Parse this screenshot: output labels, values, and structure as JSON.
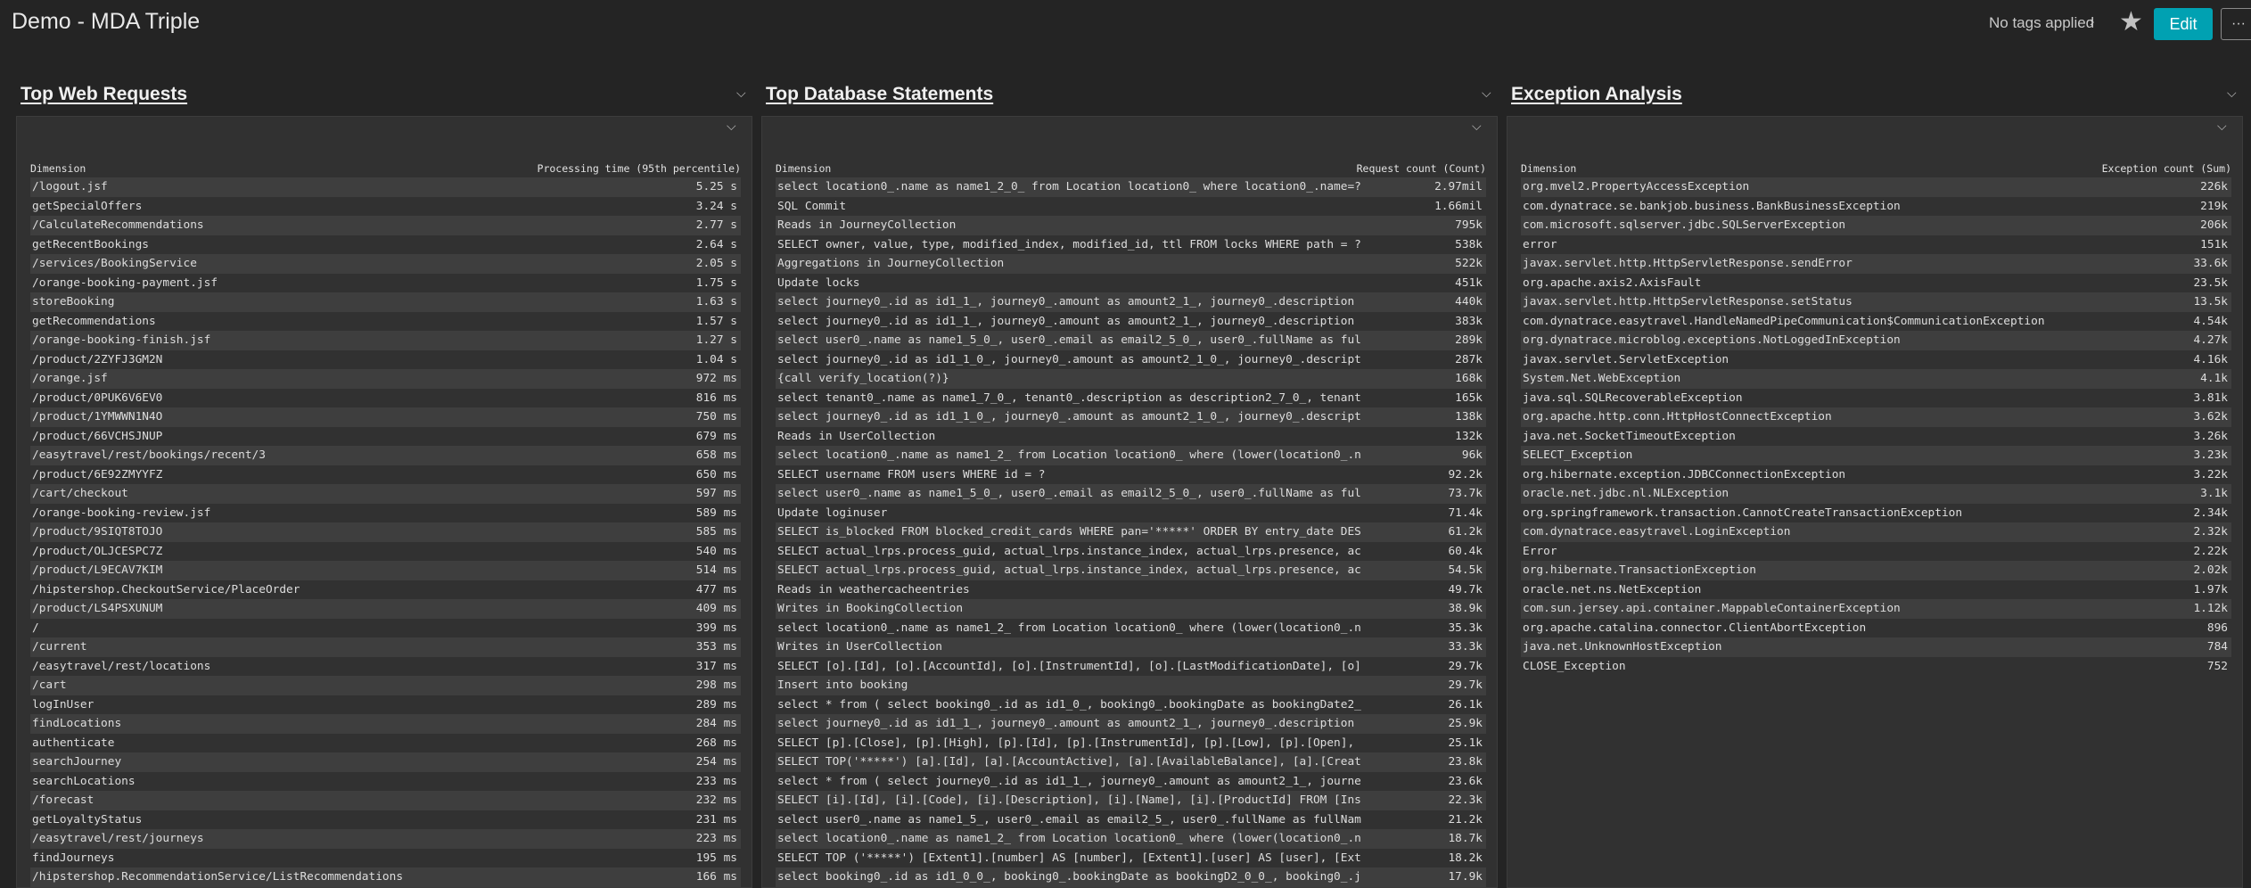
{
  "header": {
    "title": "Demo - MDA Triple",
    "tags_label": "No tags applied",
    "edit_label": "Edit",
    "more_label": "···"
  },
  "sections": [
    {
      "title": "Top Web Requests",
      "col_dim": "Dimension",
      "col_val": "Processing time (95th percentile)",
      "rows": [
        [
          "/logout.jsf",
          "5.25 s"
        ],
        [
          "getSpecialOffers",
          "3.24 s"
        ],
        [
          "/CalculateRecommendations",
          "2.77 s"
        ],
        [
          "getRecentBookings",
          "2.64 s"
        ],
        [
          "/services/BookingService",
          "2.05 s"
        ],
        [
          "/orange-booking-payment.jsf",
          "1.75 s"
        ],
        [
          "storeBooking",
          "1.63 s"
        ],
        [
          "getRecommendations",
          "1.57 s"
        ],
        [
          "/orange-booking-finish.jsf",
          "1.27 s"
        ],
        [
          "/product/2ZYFJ3GM2N",
          "1.04 s"
        ],
        [
          "/orange.jsf",
          "972 ms"
        ],
        [
          "/product/0PUK6V6EV0",
          "816 ms"
        ],
        [
          "/product/1YMWWN1N4O",
          "750 ms"
        ],
        [
          "/product/66VCHSJNUP",
          "679 ms"
        ],
        [
          "/easytravel/rest/bookings/recent/3",
          "658 ms"
        ],
        [
          "/product/6E92ZMYYFZ",
          "650 ms"
        ],
        [
          "/cart/checkout",
          "597 ms"
        ],
        [
          "/orange-booking-review.jsf",
          "589 ms"
        ],
        [
          "/product/9SIQT8TOJO",
          "585 ms"
        ],
        [
          "/product/OLJCESPC7Z",
          "540 ms"
        ],
        [
          "/product/L9ECAV7KIM",
          "514 ms"
        ],
        [
          "/hipstershop.CheckoutService/PlaceOrder",
          "477 ms"
        ],
        [
          "/product/LS4PSXUNUM",
          "409 ms"
        ],
        [
          "/",
          "399 ms"
        ],
        [
          "/current",
          "353 ms"
        ],
        [
          "/easytravel/rest/locations",
          "317 ms"
        ],
        [
          "/cart",
          "298 ms"
        ],
        [
          "logInUser",
          "289 ms"
        ],
        [
          "findLocations",
          "284 ms"
        ],
        [
          "authenticate",
          "268 ms"
        ],
        [
          "searchJourney",
          "254 ms"
        ],
        [
          "searchLocations",
          "233 ms"
        ],
        [
          "/forecast",
          "232 ms"
        ],
        [
          "getLoyaltyStatus",
          "231 ms"
        ],
        [
          "/easytravel/rest/journeys",
          "223 ms"
        ],
        [
          "findJourneys",
          "195 ms"
        ],
        [
          "/hipstershop.RecommendationService/ListRecommendations",
          "166 ms"
        ]
      ]
    },
    {
      "title": "Top Database Statements",
      "col_dim": "Dimension",
      "col_val": "Request count (Count)",
      "rows": [
        [
          "select location0_.name as name1_2_0_ from Location location0_ where location0_.name=?",
          "2.97mil"
        ],
        [
          "SQL Commit",
          "1.66mil"
        ],
        [
          "Reads in JourneyCollection",
          "795k"
        ],
        [
          "SELECT owner, value, type, modified_index, modified_id, ttl FROM locks WHERE path = ?",
          "538k"
        ],
        [
          "Aggregations in JourneyCollection",
          "522k"
        ],
        [
          "Update locks",
          "451k"
        ],
        [
          "select journey0_.id as id1_1_, journey0_.amount as amount2_1_, journey0_.description",
          "440k"
        ],
        [
          "select journey0_.id as id1_1_, journey0_.amount as amount2_1_, journey0_.description",
          "383k"
        ],
        [
          "select user0_.name as name1_5_0_, user0_.email as email2_5_0_, user0_.fullName as ful",
          "289k"
        ],
        [
          "select journey0_.id as id1_1_0_, journey0_.amount as amount2_1_0_, journey0_.descript",
          "287k"
        ],
        [
          "{call verify_location(?)}",
          "168k"
        ],
        [
          "select tenant0_.name as name1_7_0_, tenant0_.description as description2_7_0_, tenant",
          "165k"
        ],
        [
          "select journey0_.id as id1_1_0_, journey0_.amount as amount2_1_0_, journey0_.descript",
          "138k"
        ],
        [
          "Reads in UserCollection",
          "132k"
        ],
        [
          "select location0_.name as name1_2_ from Location location0_ where (lower(location0_.n",
          "96k"
        ],
        [
          "SELECT username FROM users WHERE id = ?",
          "92.2k"
        ],
        [
          "select user0_.name as name1_5_0_, user0_.email as email2_5_0_, user0_.fullName as ful",
          "73.7k"
        ],
        [
          "Update loginuser",
          "71.4k"
        ],
        [
          "SELECT is_blocked FROM blocked_credit_cards WHERE pan='*****' ORDER BY entry_date DES",
          "61.2k"
        ],
        [
          "SELECT actual_lrps.process_guid, actual_lrps.instance_index, actual_lrps.presence, ac",
          "60.4k"
        ],
        [
          "SELECT actual_lrps.process_guid, actual_lrps.instance_index, actual_lrps.presence, ac",
          "54.5k"
        ],
        [
          "Reads in weathercacheentries",
          "49.7k"
        ],
        [
          "Writes in BookingCollection",
          "38.9k"
        ],
        [
          "select location0_.name as name1_2_ from Location location0_ where (lower(location0_.n",
          "35.3k"
        ],
        [
          "Writes in UserCollection",
          "33.3k"
        ],
        [
          "SELECT [o].[Id], [o].[AccountId], [o].[InstrumentId], [o].[LastModificationDate], [o]",
          "29.7k"
        ],
        [
          "Insert into booking",
          "29.7k"
        ],
        [
          "select * from ( select booking0_.id as id1_0_, booking0_.bookingDate as bookingDate2_",
          "26.1k"
        ],
        [
          "select journey0_.id as id1_1_, journey0_.amount as amount2_1_, journey0_.description",
          "25.9k"
        ],
        [
          "SELECT [p].[Close], [p].[High], [p].[Id], [p].[InstrumentId], [p].[Low], [p].[Open],",
          "25.1k"
        ],
        [
          "SELECT TOP('*****') [a].[Id], [a].[AccountActive], [a].[AvailableBalance], [a].[Creat",
          "23.8k"
        ],
        [
          "select * from ( select journey0_.id as id1_1_, journey0_.amount as amount2_1_, journe",
          "23.6k"
        ],
        [
          "SELECT [i].[Id], [i].[Code], [i].[Description], [i].[Name], [i].[ProductId] FROM [Ins",
          "22.3k"
        ],
        [
          "select user0_.name as name1_5_, user0_.email as email2_5_, user0_.fullName as fullNam",
          "21.2k"
        ],
        [
          "select location0_.name as name1_2_ from Location location0_ where (lower(location0_.n",
          "18.7k"
        ],
        [
          "SELECT TOP ('*****') [Extent1].[number] AS [number], [Extent1].[user] AS [user], [Ext",
          "18.2k"
        ],
        [
          "select booking0_.id as id1_0_0_, booking0_.bookingDate as bookingD2_0_0_, booking0_.j",
          "17.9k"
        ]
      ]
    },
    {
      "title": "Exception Analysis",
      "col_dim": "Dimension",
      "col_val": "Exception count (Sum)",
      "rows": [
        [
          "org.mvel2.PropertyAccessException",
          "226k"
        ],
        [
          "com.dynatrace.se.bankjob.business.BankBusinessException",
          "219k"
        ],
        [
          "com.microsoft.sqlserver.jdbc.SQLServerException",
          "206k"
        ],
        [
          "error",
          "151k"
        ],
        [
          "javax.servlet.http.HttpServletResponse.sendError",
          "33.6k"
        ],
        [
          "org.apache.axis2.AxisFault",
          "23.5k"
        ],
        [
          "javax.servlet.http.HttpServletResponse.setStatus",
          "13.5k"
        ],
        [
          "com.dynatrace.easytravel.HandleNamedPipeCommunication$CommunicationException",
          "4.54k"
        ],
        [
          "org.dynatrace.microblog.exceptions.NotLoggedInException",
          "4.27k"
        ],
        [
          "javax.servlet.ServletException",
          "4.16k"
        ],
        [
          "System.Net.WebException",
          "4.1k"
        ],
        [
          "java.sql.SQLRecoverableException",
          "3.81k"
        ],
        [
          "org.apache.http.conn.HttpHostConnectException",
          "3.62k"
        ],
        [
          "java.net.SocketTimeoutException",
          "3.26k"
        ],
        [
          "SELECT_Exception",
          "3.23k"
        ],
        [
          "org.hibernate.exception.JDBCConnectionException",
          "3.22k"
        ],
        [
          "oracle.net.jdbc.nl.NLException",
          "3.1k"
        ],
        [
          "org.springframework.transaction.CannotCreateTransactionException",
          "2.34k"
        ],
        [
          "com.dynatrace.easytravel.LoginException",
          "2.32k"
        ],
        [
          "Error",
          "2.22k"
        ],
        [
          "org.hibernate.TransactionException",
          "2.02k"
        ],
        [
          "oracle.net.ns.NetException",
          "1.97k"
        ],
        [
          "com.sun.jersey.api.container.MappableContainerException",
          "1.12k"
        ],
        [
          "org.apache.catalina.connector.ClientAbortException",
          "896"
        ],
        [
          "java.net.UnknownHostException",
          "784"
        ],
        [
          "CLOSE_Exception",
          "752"
        ]
      ]
    }
  ]
}
